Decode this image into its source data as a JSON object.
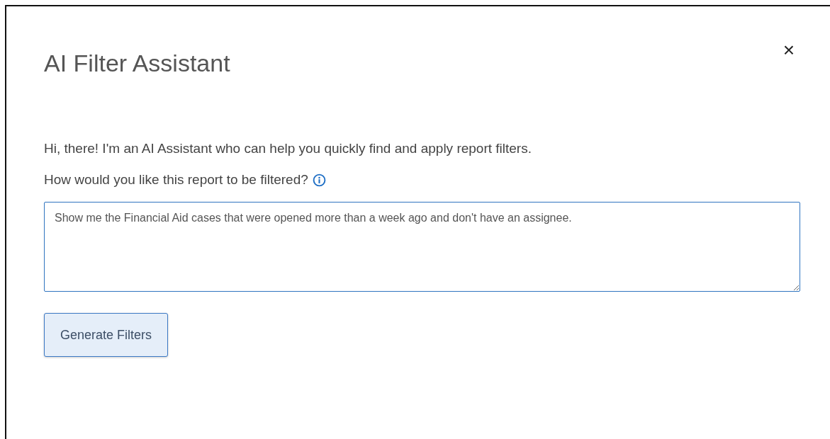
{
  "dialog": {
    "title": "AI Filter Assistant",
    "close": "×",
    "intro": "Hi, there! I'm an AI Assistant who can help you quickly find and apply report filters.",
    "question": "How would you like this report to be filtered?",
    "query": {
      "value": "Show me the Financial Aid cases that were opened more than a week ago and don't have an assignee."
    },
    "buttons": [
      {
        "label": "Generate Filters"
      }
    ]
  }
}
